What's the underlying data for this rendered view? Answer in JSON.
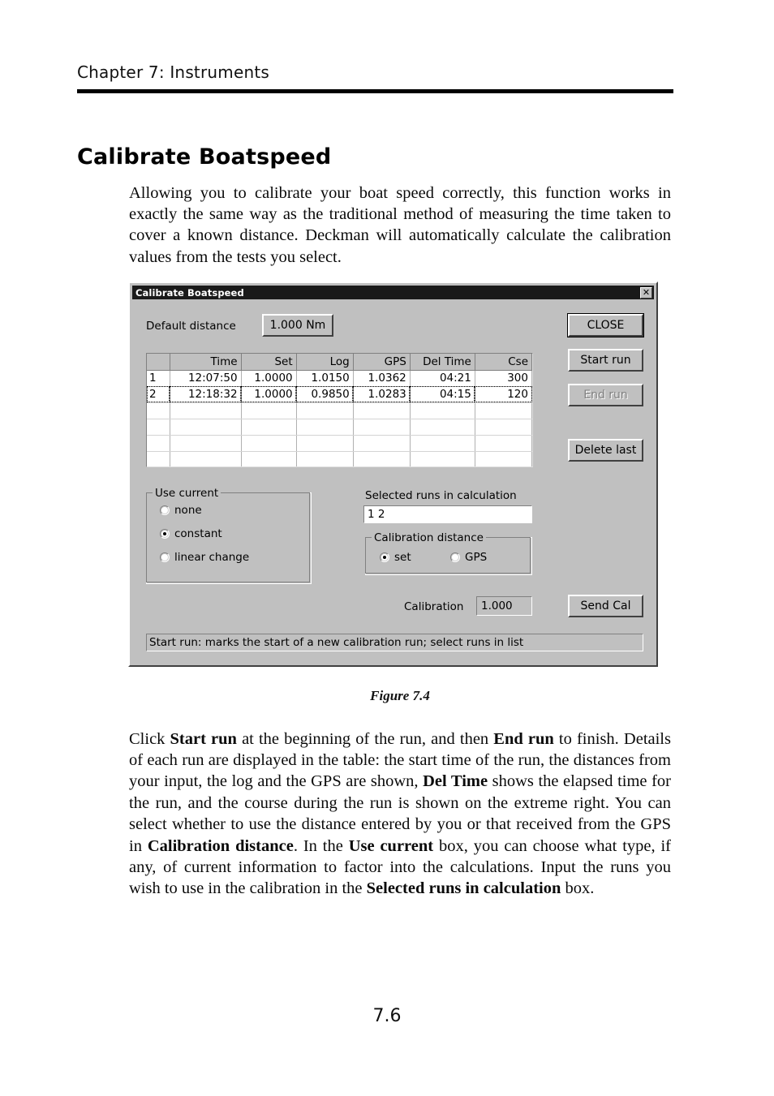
{
  "page": {
    "running_head": "Chapter 7: Instruments",
    "page_number": "7.6",
    "heading": "Calibrate Boatspeed",
    "intro_paragraph": "Allowing you to calibrate your boat speed correctly, this function works in exactly the same way as the traditional method of measuring the time taken to cover a known distance. Deckman will automatically calculate the calibration values from the tests you select.",
    "figure_caption": "Figure 7.4"
  },
  "detail_paragraph": {
    "p1": "Click ",
    "b1": "Start run",
    "p2": " at the beginning of the run, and then ",
    "b2": "End run",
    "p3": " to finish. Details of each run are displayed in the table: the start time of the run, the distances from your input, the log and the GPS are shown, ",
    "b3": "Del Time",
    "p4": " shows the elapsed time for the run, and the course during the run is shown on the extreme right. You can select whether to use the distance entered by you or that received from the GPS in ",
    "b4": "Calibration distance",
    "p5": ". In the ",
    "b5": "Use current",
    "p6": " box, you can choose what type, if any, of current information to factor into the calculations. Input the runs you wish to use in the calibration in the ",
    "b6": "Selected runs in calculation",
    "p7": " box."
  },
  "dialog": {
    "title": "Calibrate Boatspeed",
    "close_icon": "close-icon",
    "close_glyph": "✕",
    "default_distance_label": "Default distance",
    "default_distance_value": "1.000 Nm",
    "buttons": {
      "close": "CLOSE",
      "start_run": "Start run",
      "end_run": "End run",
      "delete_last": "Delete last",
      "send_cal": "Send Cal"
    },
    "end_run_enabled": false,
    "table": {
      "columns": [
        "",
        "Time",
        "Set",
        "Log",
        "GPS",
        "Del Time",
        "Cse"
      ],
      "rows": [
        {
          "num": "1",
          "time": "12:07:50",
          "set": "1.0000",
          "log": "1.0150",
          "gps": "1.0362",
          "del_time": "04:21",
          "cse": "300",
          "selected": false
        },
        {
          "num": "2",
          "time": "12:18:32",
          "set": "1.0000",
          "log": "0.9850",
          "gps": "1.0283",
          "del_time": "04:15",
          "cse": "120",
          "selected": true
        }
      ],
      "empty_row_count": 4
    },
    "use_current": {
      "title": "Use current",
      "options": [
        {
          "label": "none",
          "selected": false
        },
        {
          "label": "constant",
          "selected": true
        },
        {
          "label": "linear change",
          "selected": false
        }
      ]
    },
    "selected_runs": {
      "label": "Selected runs in calculation",
      "value": "1   2"
    },
    "calibration_distance": {
      "title": "Calibration distance",
      "options": [
        {
          "label": "set",
          "selected": true
        },
        {
          "label": "GPS",
          "selected": false
        }
      ]
    },
    "calibration": {
      "label": "Calibration",
      "value": "1.000"
    },
    "status_text": "Start run: marks the start of a new calibration run; select runs in list"
  },
  "colors": {
    "dialog_face": "#c0c0c0",
    "titlebar": "#1a1a1a",
    "shadow": "#808080",
    "highlight": "#ffffff",
    "text": "#000000",
    "disabled_text": "#808080"
  }
}
